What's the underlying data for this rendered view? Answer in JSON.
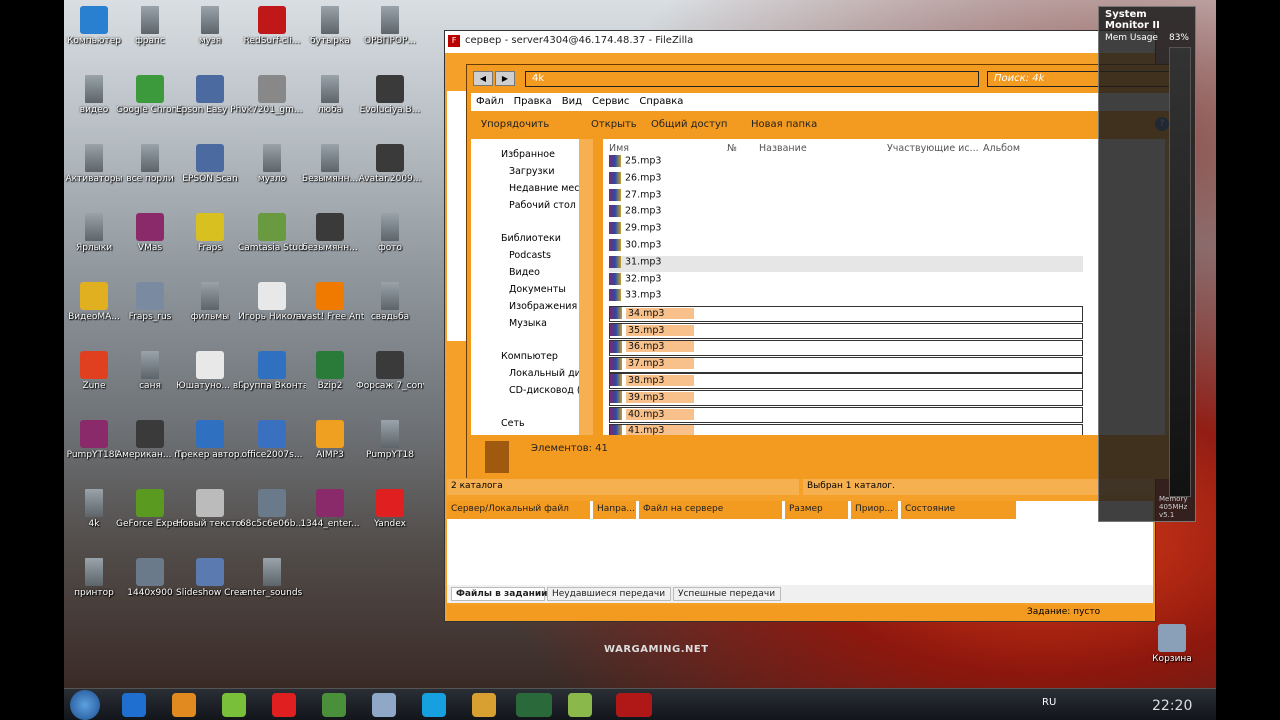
{
  "desktop_icons": [
    {
      "label": "Компьютер",
      "icon": "computer-icon"
    },
    {
      "label": "фрапс",
      "icon": "folder-icon"
    },
    {
      "label": "музя",
      "icon": "folder-icon"
    },
    {
      "label": "RedSurf-cli...",
      "icon": "redsurf-icon"
    },
    {
      "label": "бутырка",
      "icon": "folder-icon"
    },
    {
      "label": "ОРВПРОР...",
      "icon": "folder-icon"
    },
    {
      "label": "видео",
      "icon": "folder-icon"
    },
    {
      "label": "Google Chrome",
      "icon": "chrome-icon"
    },
    {
      "label": "Epson Easy Photo Print",
      "icon": "epson-icon"
    },
    {
      "label": "vk7201_gm...",
      "icon": "file-icon"
    },
    {
      "label": "люба",
      "icon": "folder-icon"
    },
    {
      "label": "Evoluciya.B...",
      "icon": "video-icon"
    },
    {
      "label": "Активаторы",
      "icon": "folder-icon"
    },
    {
      "label": "все порли",
      "icon": "folder-icon"
    },
    {
      "label": "EPSON Scan",
      "icon": "scanner-icon"
    },
    {
      "label": "музло",
      "icon": "folder-icon"
    },
    {
      "label": "Безымянн...",
      "icon": "folder-icon"
    },
    {
      "label": "Avatar.2009...",
      "icon": "video-icon"
    },
    {
      "label": "Ярлыки",
      "icon": "folder-icon"
    },
    {
      "label": "VMas",
      "icon": "winrar-icon"
    },
    {
      "label": "Fraps",
      "icon": "fraps-icon"
    },
    {
      "label": "Camtasia Studio 7",
      "icon": "camtasia-icon"
    },
    {
      "label": "безымянн...",
      "icon": "video-icon"
    },
    {
      "label": "фото",
      "icon": "folder-icon"
    },
    {
      "label": "ВидеоМА...",
      "icon": "video-master-icon"
    },
    {
      "label": "Fraps_rus",
      "icon": "installer-icon"
    },
    {
      "label": "фильмы",
      "icon": "folder-icon"
    },
    {
      "label": "Игорь Николаев...",
      "icon": "mp3-icon"
    },
    {
      "label": "avast! Free Antivirus",
      "icon": "avast-icon"
    },
    {
      "label": "свадьба",
      "icon": "folder-icon"
    },
    {
      "label": "Zune",
      "icon": "zune-icon"
    },
    {
      "label": "саня",
      "icon": "folder-icon"
    },
    {
      "label": "Юшатуно... вып",
      "icon": "mp3-icon"
    },
    {
      "label": "Группа Вконтакте",
      "icon": "network-icon"
    },
    {
      "label": "Bzip2",
      "icon": "bzip-icon"
    },
    {
      "label": "Форсаж 7_converted",
      "icon": "video-icon"
    },
    {
      "label": "PumpYT18D",
      "icon": "winrar-icon"
    },
    {
      "label": "Американ... пирог 1",
      "icon": "video-icon"
    },
    {
      "label": "Трекер автор...",
      "icon": "network-icon"
    },
    {
      "label": "office2007s...",
      "icon": "office-icon"
    },
    {
      "label": "AIMP3",
      "icon": "aimp-icon"
    },
    {
      "label": "PumpYT18",
      "icon": "folder-icon"
    },
    {
      "label": "4k",
      "icon": "folder-icon"
    },
    {
      "label": "GeForce Experience",
      "icon": "nvidia-icon"
    },
    {
      "label": "Новый текстов...",
      "icon": "text-file-icon"
    },
    {
      "label": "68c5c6e06b...",
      "icon": "image-icon"
    },
    {
      "label": "1344_enter...",
      "icon": "winrar-icon"
    },
    {
      "label": "Yandex",
      "icon": "yandex-icon"
    },
    {
      "label": "принтор",
      "icon": "folder-icon"
    },
    {
      "label": "1440x900",
      "icon": "image-icon"
    },
    {
      "label": "Slideshow Creator",
      "icon": "slideshow-icon"
    },
    {
      "label": "enter_sounds",
      "icon": "folder-icon"
    },
    {
      "label": "Корзина",
      "icon": "recycle-bin-icon"
    }
  ],
  "filezilla": {
    "title": "сервер - server4304@46.174.48.37 - FileZilla",
    "left_status": "2 каталога",
    "right_status": "Выбран 1 каталог.",
    "queue_columns": [
      "Сервер/Локальный файл",
      "Напра...",
      "Файл на сервере",
      "Размер",
      "Приор...",
      "Состояние"
    ],
    "queue_tabs": [
      "Файлы в задании",
      "Неудавшиеся передачи",
      "Успешные передачи"
    ],
    "queue_status": "Задание: пусто"
  },
  "explorer": {
    "path": "4k",
    "search_placeholder": "Поиск: 4k",
    "menu": [
      "Файл",
      "Правка",
      "Вид",
      "Сервис",
      "Справка"
    ],
    "toolbar": {
      "organize": "Упорядочить",
      "open": "Открыть",
      "share": "Общий доступ",
      "new_folder": "Новая папка"
    },
    "nav": {
      "favorites": "Избранное",
      "downloads": "Загрузки",
      "recent": "Недавние места",
      "desktop": "Рабочий стол",
      "libraries": "Библиотеки",
      "podcasts": "Podcasts",
      "video": "Видео",
      "documents": "Документы",
      "images": "Изображения",
      "music": "Музыка",
      "computer": "Компьютер",
      "local_disk": "Локальный диск",
      "cd_drive": "CD-дисковод (G:",
      "network": "Сеть"
    },
    "columns": {
      "name": "Имя",
      "number": "№",
      "title": "Название",
      "artists": "Участвующие ис...",
      "album": "Альбом"
    },
    "files": [
      "25.mp3",
      "26.mp3",
      "27.mp3",
      "28.mp3",
      "29.mp3",
      "30.mp3",
      "31.mp3",
      "32.mp3",
      "33.mp3",
      "34.mp3",
      "35.mp3",
      "36.mp3",
      "37.mp3",
      "38.mp3",
      "39.mp3",
      "40.mp3",
      "41.mp3"
    ],
    "item_count": "Элементов: 41"
  },
  "sysmon": {
    "title": "System Monitor II",
    "mem_label": "Mem Usage",
    "mem_value": "83%",
    "footer": "Memory 405MHz v5.1"
  },
  "watermark": "WARGAMING.NET",
  "tray": {
    "lang": "RU",
    "time": "22:20"
  },
  "colors": {
    "accent": "#f39a20",
    "selection": "#f8c08a"
  }
}
